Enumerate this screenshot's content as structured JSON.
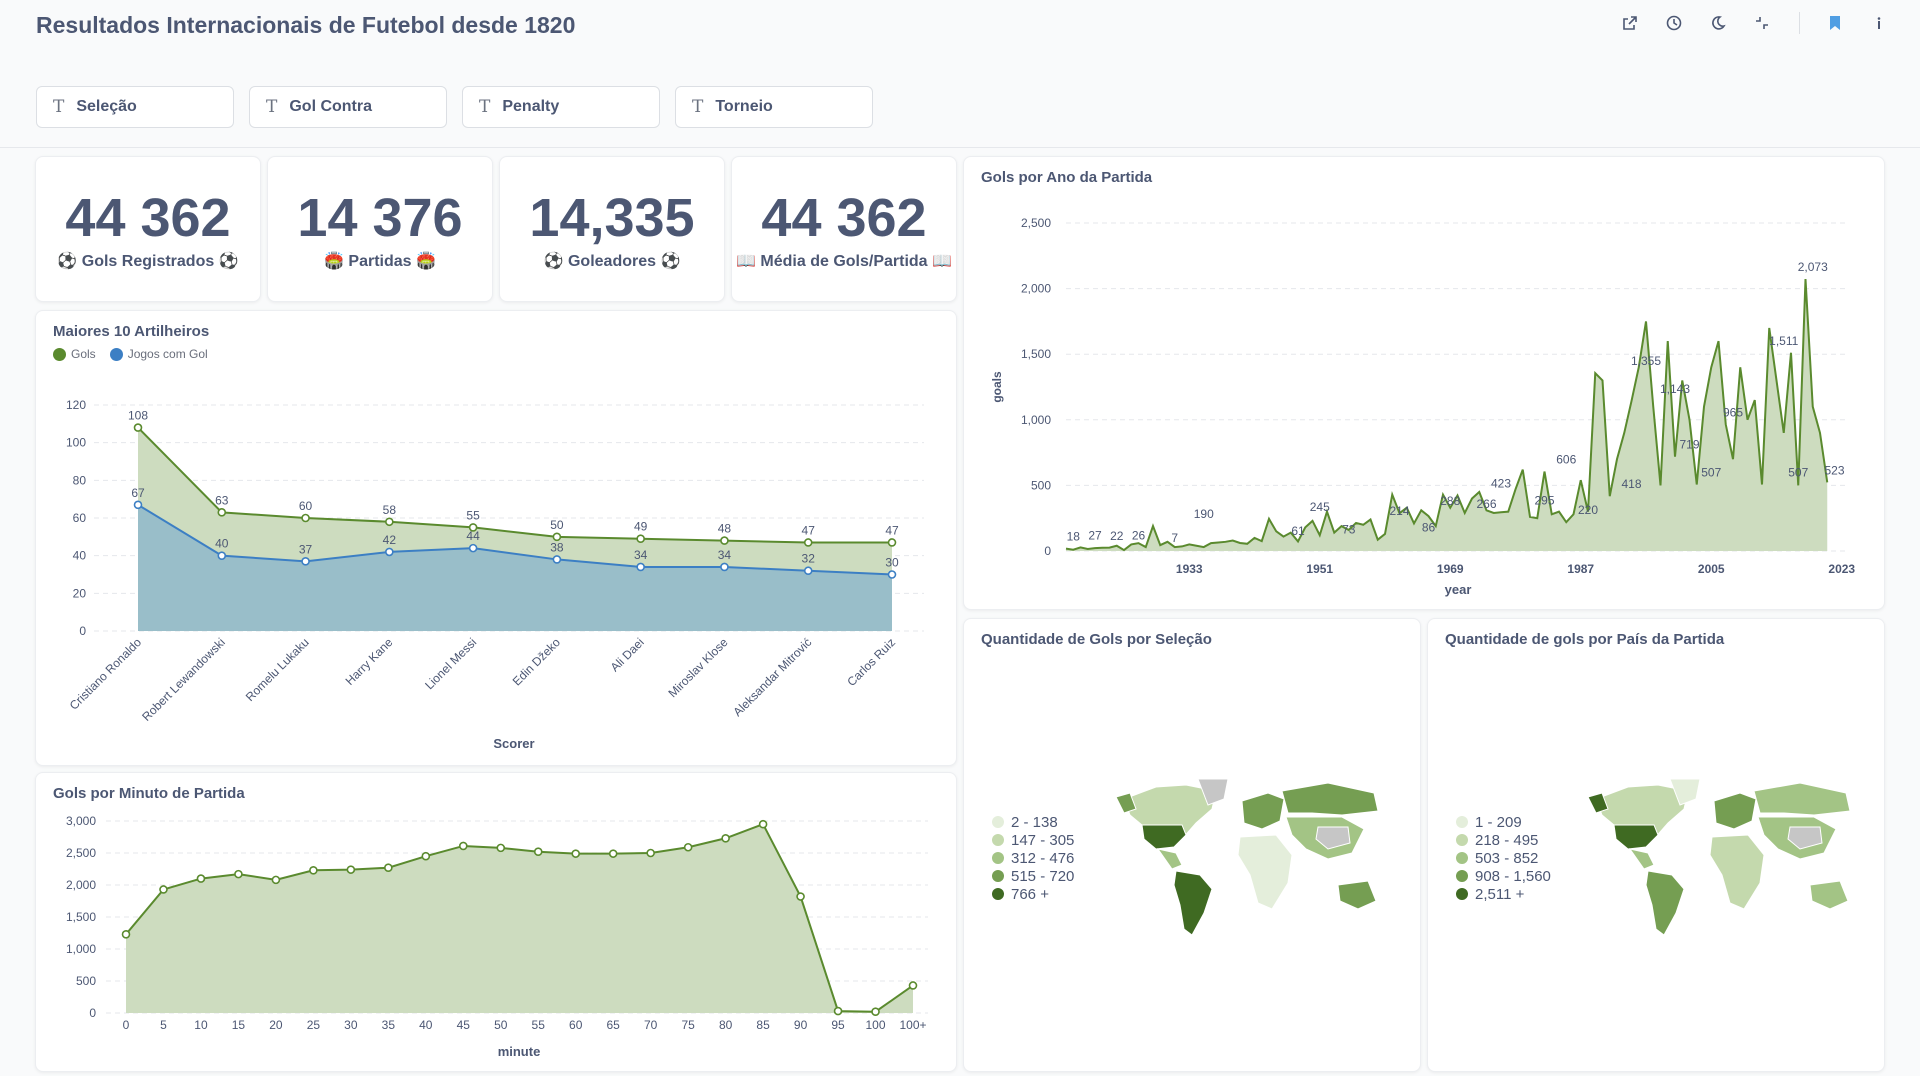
{
  "header": {
    "title": "Resultados Internacionais de Futebol desde 1820",
    "tools": [
      {
        "icon": "share-icon"
      },
      {
        "icon": "history-icon"
      },
      {
        "icon": "night-mode-icon"
      },
      {
        "icon": "exit-fullscreen-icon"
      },
      {
        "icon": "bookmark-icon"
      },
      {
        "icon": "info-icon"
      }
    ]
  },
  "filters": [
    {
      "label": "Seleção",
      "icon": "text-filter-icon"
    },
    {
      "label": "Gol Contra",
      "icon": "text-filter-icon"
    },
    {
      "label": "Penalty",
      "icon": "text-filter-icon"
    },
    {
      "label": "Torneio",
      "icon": "text-filter-icon"
    }
  ],
  "kpis": [
    {
      "value": "44 362",
      "label": "⚽ Gols Registrados ⚽"
    },
    {
      "value": "14 376",
      "label": "🏟️ Partidas 🏟️"
    },
    {
      "value": "14,335",
      "label": "⚽ Goleadores ⚽"
    },
    {
      "value": "44 362",
      "label": "📖 Média de Gols/Partida 📖"
    }
  ],
  "colors": {
    "green": "#5a8a2e",
    "green_fill": "#cddcbf",
    "blue": "#3c7fc4",
    "blue_fill": "#99bec9"
  },
  "chart_data": [
    {
      "id": "scorers",
      "type": "area",
      "title": "Maiores 10 Artilheiros",
      "xlabel": "Scorer",
      "ylabel": "",
      "ylim": [
        0,
        120
      ],
      "yticks": [
        0,
        20,
        40,
        60,
        80,
        100,
        120
      ],
      "categories": [
        "Cristiano Ronaldo",
        "Robert Lewandowski",
        "Romelu Lukaku",
        "Harry Kane",
        "Lionel Messi",
        "Edin Džeko",
        "Ali Daei",
        "Miroslav Klose",
        "Aleksandar Mitrović",
        "Carlos Ruiz"
      ],
      "series": [
        {
          "name": "Gols",
          "color": "#5a8a2e",
          "values": [
            108,
            63,
            60,
            58,
            55,
            50,
            49,
            48,
            47,
            47
          ]
        },
        {
          "name": "Jogos com Gol",
          "color": "#3c7fc4",
          "values": [
            67,
            40,
            37,
            42,
            44,
            38,
            34,
            34,
            32,
            30
          ]
        }
      ],
      "legend": "top-left",
      "grid": true
    },
    {
      "id": "by_year",
      "type": "area",
      "title": "Gols por Ano da Partida",
      "xlabel": "year",
      "ylabel": "goals",
      "ylim": [
        0,
        2500
      ],
      "yticks": [
        "0",
        "500",
        "1,000",
        "1,500",
        "2,000",
        "2,500"
      ],
      "xticks": [
        "1933",
        "1951",
        "1969",
        "1987",
        "2005",
        "2023"
      ],
      "x_range": [
        1916,
        2024
      ],
      "values": [
        18,
        10,
        27,
        15,
        22,
        25,
        26,
        40,
        7,
        50,
        60,
        30,
        190,
        45,
        70,
        30,
        35,
        50,
        40,
        30,
        60,
        65,
        70,
        80,
        61,
        55,
        100,
        75,
        245,
        150,
        110,
        140,
        73,
        180,
        230,
        120,
        300,
        140,
        190,
        160,
        214,
        200,
        240,
        86,
        130,
        430,
        288,
        330,
        210,
        310,
        266,
        190,
        430,
        330,
        423,
        290,
        400,
        450,
        310,
        290,
        295,
        300,
        470,
        620,
        260,
        250,
        606,
        280,
        300,
        220,
        280,
        540,
        300,
        1355,
        1300,
        418,
        700,
        900,
        1143,
        1400,
        1750,
        1100,
        500,
        1600,
        719,
        1300,
        1000,
        507,
        1100,
        1400,
        1600,
        965,
        700,
        1400,
        1000,
        1150,
        507,
        1700,
        1300,
        900,
        1511,
        500,
        2073,
        1100,
        900,
        523
      ],
      "point_labels": [
        {
          "x": 1917,
          "text": "18"
        },
        {
          "x": 1920,
          "text": "27"
        },
        {
          "x": 1923,
          "text": "22"
        },
        {
          "x": 1926,
          "text": "26"
        },
        {
          "x": 1931,
          "text": "7"
        },
        {
          "x": 1935,
          "text": "190"
        },
        {
          "x": 1948,
          "text": "61"
        },
        {
          "x": 1951,
          "text": "245"
        },
        {
          "x": 1955,
          "text": "73"
        },
        {
          "x": 1962,
          "text": "214"
        },
        {
          "x": 1966,
          "text": "86"
        },
        {
          "x": 1969,
          "text": "288"
        },
        {
          "x": 1974,
          "text": "266"
        },
        {
          "x": 1976,
          "text": "423"
        },
        {
          "x": 1982,
          "text": "295"
        },
        {
          "x": 1985,
          "text": "606"
        },
        {
          "x": 1988,
          "text": "220"
        },
        {
          "x": 1994,
          "text": "418"
        },
        {
          "x": 1996,
          "text": "1,355"
        },
        {
          "x": 2000,
          "text": "1,143"
        },
        {
          "x": 2002,
          "text": "719"
        },
        {
          "x": 2005,
          "text": "507"
        },
        {
          "x": 2008,
          "text": "965"
        },
        {
          "x": 2015,
          "text": "1,511"
        },
        {
          "x": 2017,
          "text": "507"
        },
        {
          "x": 2019,
          "text": "2,073"
        },
        {
          "x": 2022,
          "text": "523"
        }
      ],
      "grid": true
    },
    {
      "id": "by_minute",
      "type": "area",
      "title": "Gols por Minuto de Partida",
      "xlabel": "minute",
      "ylabel": "",
      "ylim": [
        0,
        3000
      ],
      "yticks": [
        "0",
        "500",
        "1,000",
        "1,500",
        "2,000",
        "2,500",
        "3,000"
      ],
      "categories": [
        "0",
        "5",
        "10",
        "15",
        "20",
        "25",
        "30",
        "35",
        "40",
        "45",
        "50",
        "55",
        "60",
        "65",
        "70",
        "75",
        "80",
        "85",
        "90",
        "95",
        "100",
        "100+"
      ],
      "values": [
        1230,
        1930,
        2100,
        2170,
        2080,
        2230,
        2240,
        2270,
        2450,
        2610,
        2580,
        2520,
        2490,
        2490,
        2500,
        2590,
        2730,
        2950,
        1820,
        30,
        20,
        430
      ],
      "grid": true
    }
  ],
  "maps": [
    {
      "title": "Quantidade de Gols por Seleção",
      "legend": [
        {
          "label": "2 - 138",
          "color": "#e4eedb"
        },
        {
          "label": "147 - 305",
          "color": "#c4d9ad"
        },
        {
          "label": "312 - 476",
          "color": "#a3c485"
        },
        {
          "label": "515 - 720",
          "color": "#759e52"
        },
        {
          "label": "766 +",
          "color": "#3f6a22"
        }
      ]
    },
    {
      "title": "Quantidade de gols por País da Partida",
      "legend": [
        {
          "label": "1 - 209",
          "color": "#e4eedb"
        },
        {
          "label": "218 - 495",
          "color": "#c4d9ad"
        },
        {
          "label": "503 - 852",
          "color": "#a3c485"
        },
        {
          "label": "908 - 1,560",
          "color": "#759e52"
        },
        {
          "label": "2,511 +",
          "color": "#3f6a22"
        }
      ]
    }
  ]
}
